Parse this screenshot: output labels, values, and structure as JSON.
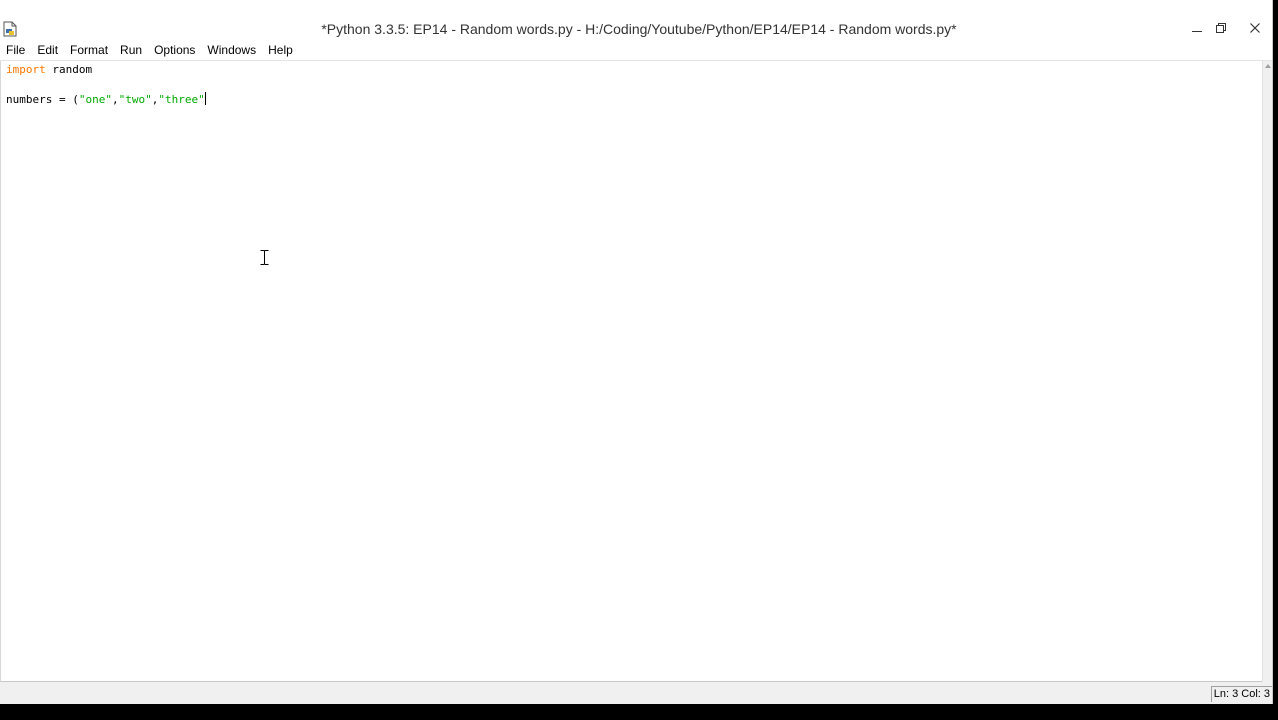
{
  "window": {
    "title": "*Python 3.3.5: EP14 - Random words.py - H:/Coding/Youtube/Python/EP14/EP14 - Random words.py*",
    "icon": "python-file-icon",
    "controls": {
      "minimize_icon": "minimize-icon",
      "restore_icon": "restore-icon",
      "close_icon": "close-icon"
    }
  },
  "menu": {
    "items": [
      "File",
      "Edit",
      "Format",
      "Run",
      "Options",
      "Windows",
      "Help"
    ]
  },
  "editor": {
    "lines": [
      [
        {
          "text": "import",
          "type": "keyword"
        },
        {
          "text": " random",
          "type": "plain"
        }
      ],
      [],
      [
        {
          "text": "numbers = (",
          "type": "plain"
        },
        {
          "text": "\"one\"",
          "type": "string"
        },
        {
          "text": ",",
          "type": "plain"
        },
        {
          "text": "\"two\"",
          "type": "string"
        },
        {
          "text": ",",
          "type": "plain"
        },
        {
          "text": "\"three\"",
          "type": "string"
        }
      ]
    ]
  },
  "status": {
    "text": "Ln: 3 Col: 3"
  },
  "colors": {
    "keyword": "#ff7700",
    "string": "#00aa00",
    "editor_background": "#ffffff",
    "chrome_background": "#f0f0f0"
  }
}
